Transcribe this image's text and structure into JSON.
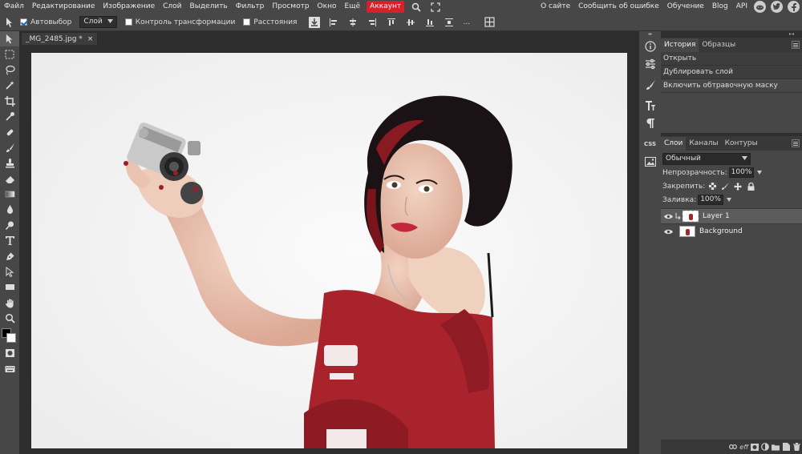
{
  "menu": {
    "items": [
      "Файл",
      "Редактирование",
      "Изображение",
      "Слой",
      "Выделить",
      "Фильтр",
      "Просмотр",
      "Окно",
      "Ещё"
    ],
    "account": "Аккаунт",
    "right_links": [
      "О сайте",
      "Сообщить об ошибке",
      "Обучение",
      "Blog",
      "API"
    ],
    "social": [
      "reddit-icon",
      "twitter-icon",
      "facebook-icon"
    ]
  },
  "options": {
    "autoselect_label": "Автовыбор",
    "autoselect_checked": true,
    "autoselect_target": "Слой",
    "transform_label": "Контроль трансформации",
    "transform_checked": false,
    "distances_label": "Расстояния",
    "distances_checked": false,
    "more": "..."
  },
  "document": {
    "tab_title": "_MG_2485.jpg *",
    "close_glyph": "×"
  },
  "history": {
    "tabs": [
      "История",
      "Образцы"
    ],
    "items": [
      "Открыть",
      "Дублировать слой",
      "Включить обтравочную маску"
    ]
  },
  "layers": {
    "tabs": [
      "Слои",
      "Каналы",
      "Контуры"
    ],
    "blend_mode": "Обычный",
    "opacity_label": "Непрозрачность:",
    "opacity_value": "100%",
    "lock_label": "Закрепить:",
    "fill_label": "Заливка:",
    "fill_value": "100%",
    "items": [
      {
        "name": "Layer 1",
        "selected": true
      },
      {
        "name": "Background",
        "selected": false
      }
    ],
    "footer_eff": "eff"
  },
  "sidestrip": {
    "css_label": "CSS"
  },
  "colors": {
    "accent": "#d6202a",
    "panel_bg": "#474747",
    "workspace_bg": "#2d2d2d",
    "foreground": "#000000",
    "background": "#ffffff"
  }
}
